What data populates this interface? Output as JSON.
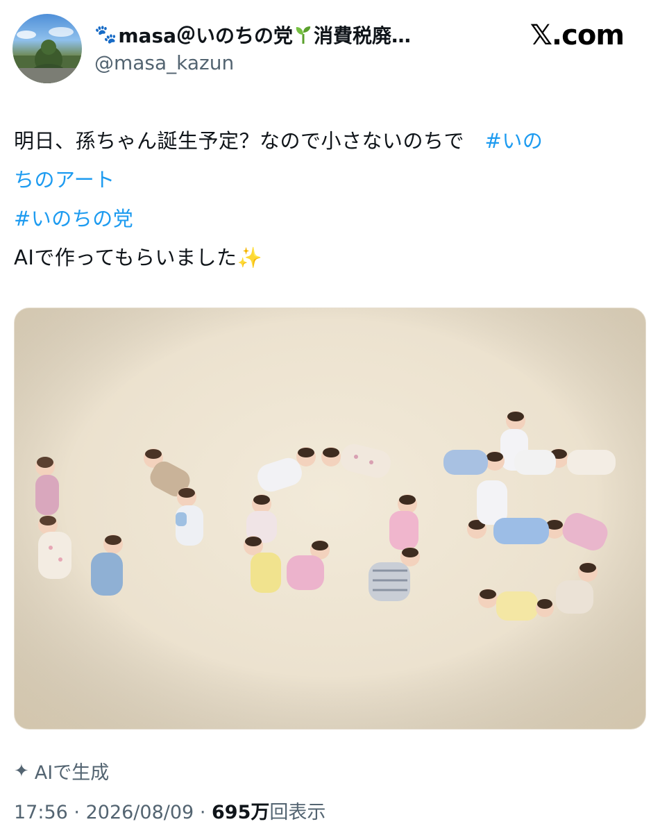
{
  "header": {
    "display_name": "masa＠いのちの党",
    "display_name_suffix": "消費税廃…",
    "handle": "@masa_kazun",
    "brand": "𝕏.com"
  },
  "tweet": {
    "line1": "明日、孫ちゃん誕生予定？なので小さないのちで　",
    "hashtag1_part1": "#いの",
    "hashtag1_part2": "ちのアート",
    "hashtag2": "#いのちの党",
    "line3": "AIで作ってもらいました",
    "sparkles": "✨"
  },
  "media": {
    "description_icon": "baby-photo-image"
  },
  "footer": {
    "ai_label": "AIで生成",
    "time": "17:56",
    "separator": "·",
    "date": "2026/08/09",
    "views_count": "695万",
    "views_label": "回表示"
  },
  "colors": {
    "hashtag": "#1d9bf0",
    "muted": "#536471",
    "text": "#0f1419"
  }
}
